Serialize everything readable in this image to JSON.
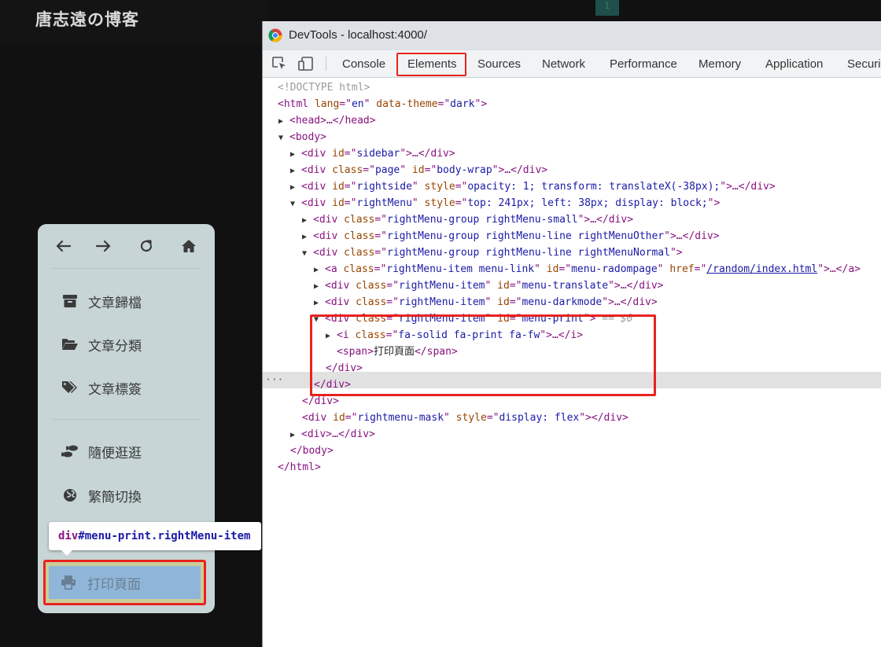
{
  "blog": {
    "title": "唐志遠の博客",
    "top_badge": "1"
  },
  "menu": {
    "nav": [
      "arrow-left-icon",
      "arrow-right-icon",
      "refresh-icon",
      "home-icon"
    ],
    "items": [
      {
        "label": "文章歸檔",
        "icon": "archive-icon"
      },
      {
        "label": "文章分類",
        "icon": "folder-open-icon"
      },
      {
        "label": "文章標簽",
        "icon": "tags-icon"
      },
      {
        "label": "隨便逛逛",
        "icon": "shoe-prints-icon"
      },
      {
        "label": "繁簡切換",
        "icon": "globe-icon"
      },
      {
        "label": "打印頁面",
        "icon": "print-icon"
      }
    ]
  },
  "tooltip": {
    "tag": "div",
    "rest": "#menu-print.rightMenu-item"
  },
  "devtools": {
    "title": "DevTools - localhost:4000/",
    "tabs": [
      "Console",
      "Elements",
      "Sources",
      "Network",
      "Performance",
      "Memory",
      "Application",
      "Securit"
    ],
    "active_tab": "Elements"
  },
  "code": {
    "doctype": "<!DOCTYPE html>",
    "html_open": [
      "<html",
      " lang",
      "=\"",
      "en",
      "\"",
      " data-theme",
      "=\"",
      "dark",
      "\"",
      ">"
    ],
    "head": "<head>…</head>",
    "body": "<body>",
    "l_sidebar": [
      "<div",
      " id",
      "=\"",
      "sidebar",
      "\"",
      ">…</div>"
    ],
    "l_page": [
      "<div",
      " class",
      "=\"",
      "page",
      "\"",
      " id",
      "=\"",
      "body-wrap",
      "\"",
      ">…</div>"
    ],
    "l_rightside": [
      "<div",
      " id",
      "=\"",
      "rightside",
      "\"",
      " style",
      "=\"",
      "opacity: 1; transform: translateX(-38px);",
      "\"",
      ">…</div>"
    ],
    "l_rightmenu": [
      "<div",
      " id",
      "=\"",
      "rightMenu",
      "\"",
      " style",
      "=\"",
      "top: 241px; left: 38px; display: block;",
      "\"",
      ">"
    ],
    "l_small": [
      "<div",
      " class",
      "=\"",
      "rightMenu-group rightMenu-small",
      "\"",
      ">…</div>"
    ],
    "l_other": [
      "<div",
      " class",
      "=\"",
      "rightMenu-group rightMenu-line rightMenuOther",
      "\"",
      ">…</div>"
    ],
    "l_normal": [
      "<div",
      " class",
      "=\"",
      "rightMenu-group rightMenu-line rightMenuNormal",
      "\"",
      ">"
    ],
    "l_a": [
      "<a",
      " class",
      "=\"",
      "rightMenu-item menu-link",
      "\"",
      " id",
      "=\"",
      "menu-radompage",
      "\"",
      " href",
      "=\"",
      "/random/index.html",
      "\"",
      ">…</a>"
    ],
    "l_translate": [
      "<div",
      " class",
      "=\"",
      "rightMenu-item",
      "\"",
      " id",
      "=\"",
      "menu-translate",
      "\"",
      ">…</div>"
    ],
    "l_darkmode": [
      "<div",
      " class",
      "=\"",
      "rightMenu-item",
      "\"",
      " id",
      "=\"",
      "menu-darkmode",
      "\"",
      ">…</div>"
    ],
    "l_print": [
      "<div",
      " class",
      "=\"",
      "rightMenu-item",
      "\"",
      " id",
      "=\"",
      "menu-print",
      "\"",
      ">"
    ],
    "l_print_ref": " == $0",
    "l_i": [
      "<i",
      " class",
      "=\"",
      "fa-solid fa-print fa-fw",
      "\"",
      ">…</i>"
    ],
    "l_span": [
      "<span>",
      "打印頁面",
      "</span>"
    ],
    "l_div_close": "</div>",
    "l_mask": [
      "<div",
      " id",
      "=\"",
      "rightmenu-mask",
      "\"",
      " style",
      "=\"",
      "display: flex",
      "\"",
      "></div>"
    ],
    "l_div_dots": "<div>…</div>",
    "body_close": "</body>",
    "html_close": "</html>"
  },
  "colors": {
    "highlight": "#e8231f",
    "menu_bg": "#c7d5d6",
    "selected_line": "#e1e1e1"
  }
}
